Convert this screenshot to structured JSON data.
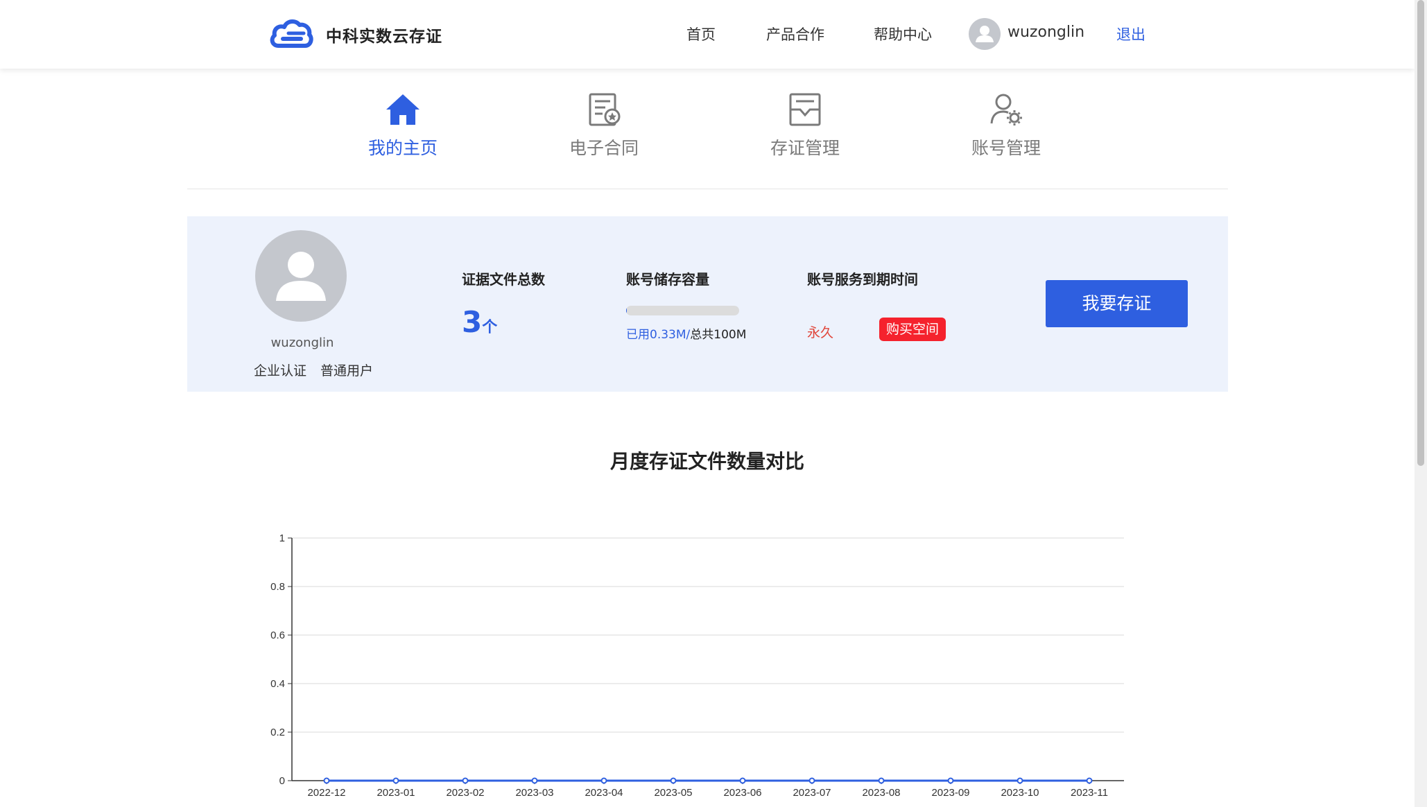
{
  "header": {
    "brand": "中科实数云存证",
    "nav": [
      "首页",
      "产品合作",
      "帮助中心"
    ],
    "username": "wuzonglin",
    "logout": "退出"
  },
  "tabs": [
    {
      "label": "我的主页",
      "icon": "home-icon",
      "active": true
    },
    {
      "label": "电子合同",
      "icon": "contract-icon",
      "active": false
    },
    {
      "label": "存证管理",
      "icon": "evidence-icon",
      "active": false
    },
    {
      "label": "账号管理",
      "icon": "account-settings-icon",
      "active": false
    }
  ],
  "profile": {
    "username": "wuzonglin",
    "tags": [
      "企业认证",
      "普通用户"
    ]
  },
  "stats": {
    "files_title": "证据文件总数",
    "files_count": "3",
    "files_unit": "个",
    "storage_title": "账号储存容量",
    "storage_used": "已用0.33M/",
    "storage_total": "总共100M",
    "storage_fraction": 0.0033,
    "expire_title": "账号服务到期时间",
    "expire_value": "永久",
    "buy_button": "购买空间"
  },
  "primary_button": "我要存证",
  "colors": {
    "accent": "#2e5fe0",
    "panel_bg": "#edf2fc",
    "danger": "#f5222d",
    "expire_text": "#e0453a"
  },
  "chart_data": {
    "type": "line",
    "title": "月度存证文件数量对比",
    "categories": [
      "2022-12",
      "2023-01",
      "2023-02",
      "2023-03",
      "2023-04",
      "2023-05",
      "2023-06",
      "2023-07",
      "2023-08",
      "2023-09",
      "2023-10",
      "2023-11"
    ],
    "values": [
      0,
      0,
      0,
      0,
      0,
      0,
      0,
      0,
      0,
      0,
      0,
      0
    ],
    "ylim": [
      0,
      1
    ],
    "yticks": [
      "0",
      "0.2",
      "0.4",
      "0.6",
      "0.8",
      "1"
    ],
    "grid": true,
    "xlabel": "",
    "ylabel": ""
  }
}
